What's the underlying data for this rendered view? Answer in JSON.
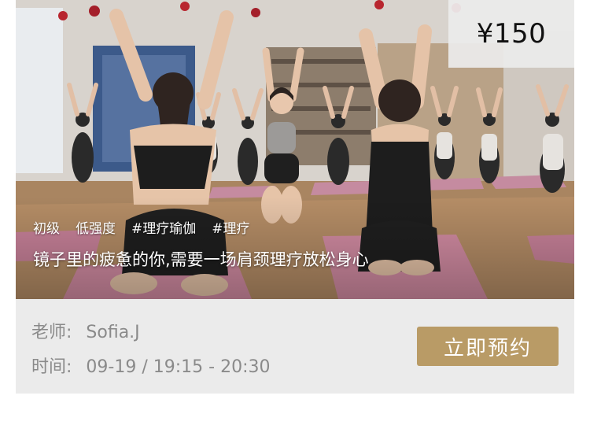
{
  "course": {
    "price": "¥150",
    "tags": [
      "初级",
      "低强度",
      "#理疗瑜伽",
      "#理疗"
    ],
    "subtitle": "镜子里的疲惫的你,需要一场肩颈理疗放松身心",
    "teacher_label": "老师:",
    "teacher_value": "Sofia.J",
    "time_label": "时间:",
    "time_value": "09-19 / 19:15 - 20:30",
    "book_button": "立即预约"
  },
  "colors": {
    "button_bg": "#b99b66",
    "card_bg": "#ebebeb",
    "text_secondary": "#8a8a8a"
  }
}
